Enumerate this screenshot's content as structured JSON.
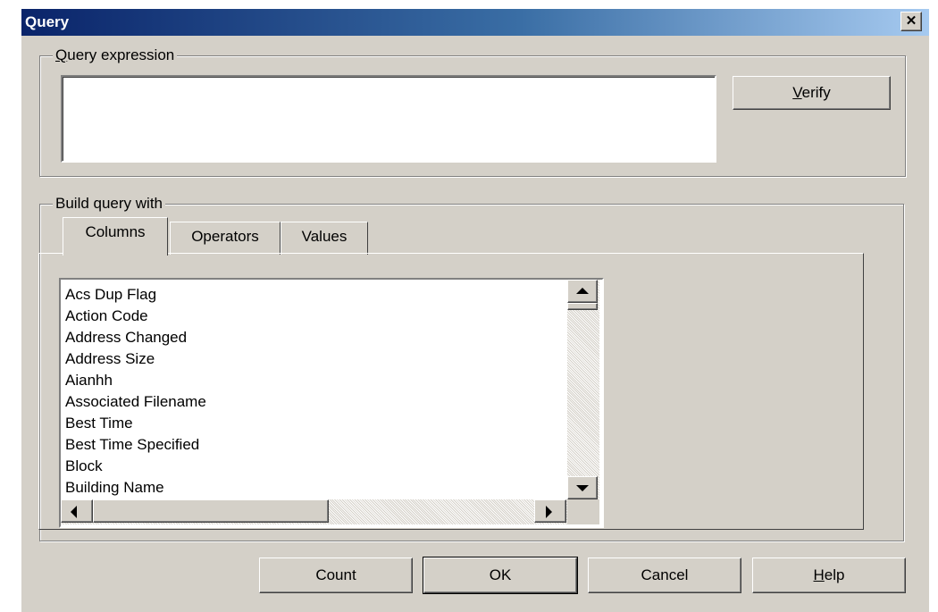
{
  "dialog": {
    "title": "Query",
    "close_label": "✕"
  },
  "query_expression": {
    "legend_accel": "Q",
    "legend_rest": "uery expression",
    "value": ""
  },
  "verify_button": {
    "accel": "V",
    "rest": "erify"
  },
  "build_group": {
    "legend": "Build query with"
  },
  "tabs": [
    {
      "label": "Columns",
      "active": true
    },
    {
      "label": "Operators",
      "active": false
    },
    {
      "label": "Values",
      "active": false
    }
  ],
  "columns_list": [
    "Acs Dup Flag",
    "Action Code",
    "Address Changed",
    "Address Size",
    "Aianhh",
    "Associated Filename",
    "Best Time",
    "Best Time Specified",
    "Block",
    "Building Name"
  ],
  "buttons": {
    "count": "Count",
    "ok": "OK",
    "cancel": "Cancel",
    "help_accel": "H",
    "help_rest": "elp"
  },
  "colors": {
    "face": "#d4d0c8",
    "title_start": "#0a246a",
    "title_end": "#a6caf0"
  }
}
